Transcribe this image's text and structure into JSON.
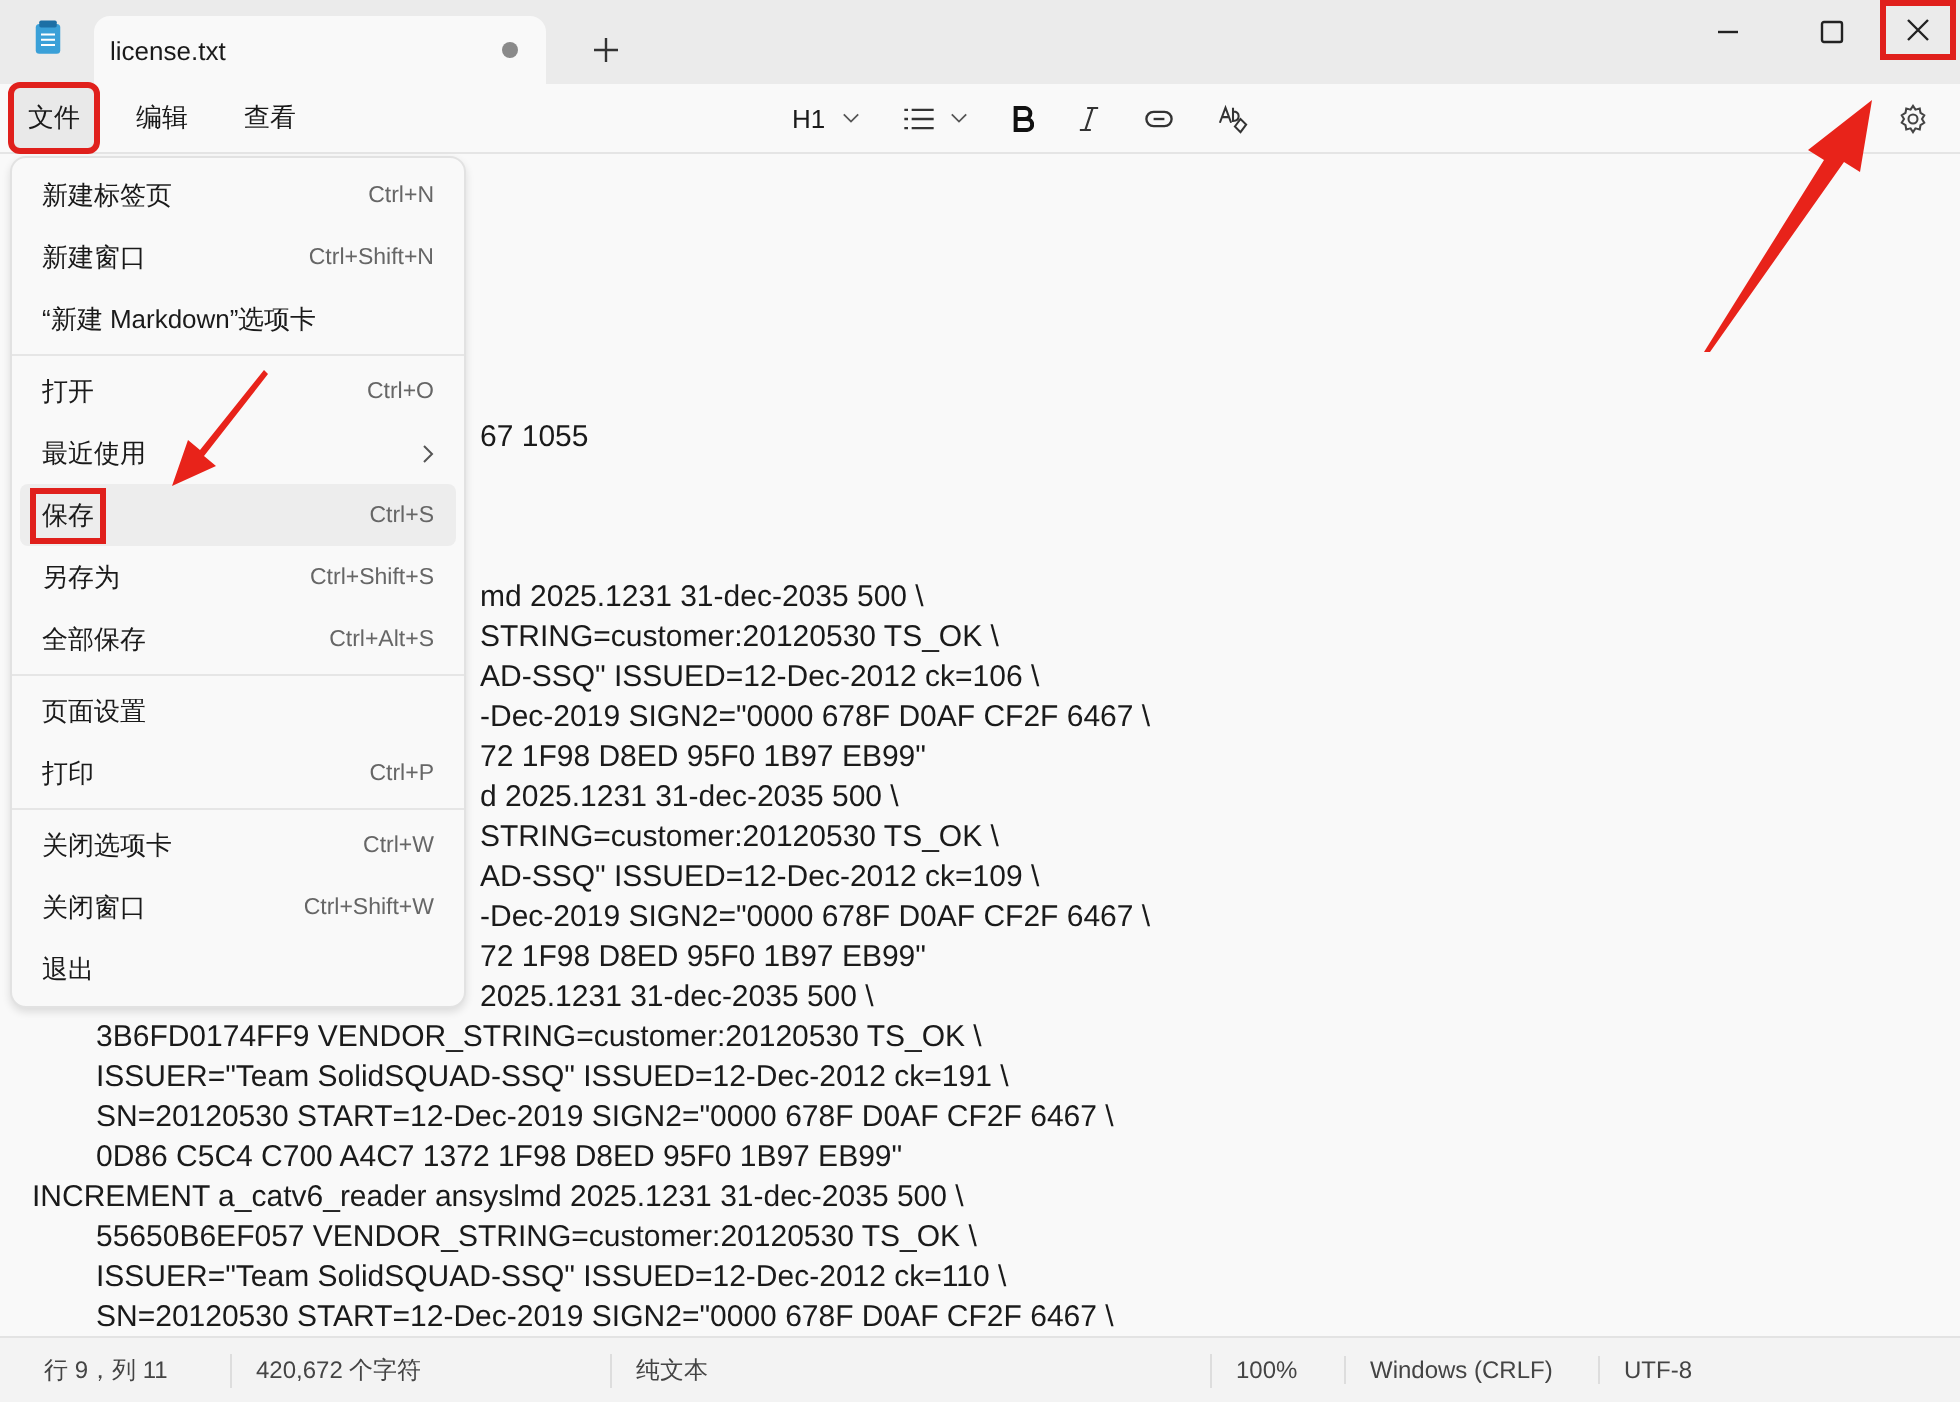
{
  "window": {
    "tab_title": "license.txt",
    "unsaved": true,
    "close_annotated": true
  },
  "menubar": [
    {
      "label": "文件",
      "selected": true,
      "annotated": true
    },
    {
      "label": "编辑",
      "selected": false,
      "annotated": false
    },
    {
      "label": "查看",
      "selected": false,
      "annotated": false
    }
  ],
  "toolbar": {
    "heading": "H1"
  },
  "file_menu": [
    [
      {
        "label": "新建标签页",
        "shortcut": "Ctrl+N",
        "selected": false,
        "annotated": false
      },
      {
        "label": "新建窗口",
        "shortcut": "Ctrl+Shift+N",
        "selected": false,
        "annotated": false
      },
      {
        "label": "“新建 Markdown”选项卡",
        "selected": false,
        "annotated": false
      }
    ],
    [
      {
        "label": "打开",
        "shortcut": "Ctrl+O",
        "selected": false,
        "annotated": false
      },
      {
        "label": "最近使用",
        "submenu": true,
        "selected": false,
        "annotated": false
      },
      {
        "label": "保存",
        "shortcut": "Ctrl+S",
        "selected": true,
        "annotated": true
      },
      {
        "label": "另存为",
        "shortcut": "Ctrl+Shift+S",
        "selected": false,
        "annotated": false
      },
      {
        "label": "全部保存",
        "shortcut": "Ctrl+Alt+S",
        "selected": false,
        "annotated": false
      }
    ],
    [
      {
        "label": "页面设置",
        "selected": false,
        "annotated": false
      },
      {
        "label": "打印",
        "shortcut": "Ctrl+P",
        "selected": false,
        "annotated": false
      }
    ],
    [
      {
        "label": "关闭选项卡",
        "shortcut": "Ctrl+W",
        "selected": false,
        "annotated": false
      },
      {
        "label": "关闭窗口",
        "shortcut": "Ctrl+Shift+W",
        "selected": false,
        "annotated": false
      },
      {
        "label": "退出",
        "selected": false,
        "annotated": false
      }
    ]
  ],
  "editor_lines": [
    {
      "kind": "blank"
    },
    {
      "kind": "blank"
    },
    {
      "kind": "blank"
    },
    {
      "kind": "blank"
    },
    {
      "kind": "blank"
    },
    {
      "kind": "blank"
    },
    {
      "kind": "cut",
      "text": "67 1055"
    },
    {
      "kind": "blank"
    },
    {
      "kind": "blank"
    },
    {
      "kind": "blank"
    },
    {
      "kind": "cut",
      "text": "md 2025.1231 31-dec-2035 500 \\"
    },
    {
      "kind": "cut",
      "text": "STRING=customer:20120530 TS_OK \\"
    },
    {
      "kind": "cut",
      "text": "AD-SSQ\" ISSUED=12-Dec-2012 ck=106 \\"
    },
    {
      "kind": "cut",
      "text": "-Dec-2019 SIGN2=\"0000 678F D0AF CF2F 6467 \\"
    },
    {
      "kind": "cut",
      "text": "72 1F98 D8ED 95F0 1B97 EB99\""
    },
    {
      "kind": "cut",
      "text": "d 2025.1231 31-dec-2035 500 \\"
    },
    {
      "kind": "cut",
      "text": "STRING=customer:20120530 TS_OK \\"
    },
    {
      "kind": "cut",
      "text": "AD-SSQ\" ISSUED=12-Dec-2012 ck=109 \\"
    },
    {
      "kind": "cut",
      "text": "-Dec-2019 SIGN2=\"0000 678F D0AF CF2F 6467 \\"
    },
    {
      "kind": "cut",
      "text": "72 1F98 D8ED 95F0 1B97 EB99\""
    },
    {
      "kind": "cut",
      "text": "2025.1231 31-dec-2035 500 \\"
    },
    {
      "kind": "cont",
      "text": "3B6FD0174FF9 VENDOR_STRING=customer:20120530 TS_OK \\"
    },
    {
      "kind": "cont",
      "text": "ISSUER=\"Team SolidSQUAD-SSQ\" ISSUED=12-Dec-2012 ck=191 \\"
    },
    {
      "kind": "cont",
      "text": "SN=20120530 START=12-Dec-2019 SIGN2=\"0000 678F D0AF CF2F 6467 \\"
    },
    {
      "kind": "cont",
      "text": "0D86 C5C4 C700 A4C7 1372 1F98 D8ED 95F0 1B97 EB99\""
    },
    {
      "kind": "head",
      "text": "INCREMENT a_catv6_reader ansyslmd 2025.1231 31-dec-2035 500 \\"
    },
    {
      "kind": "cont",
      "text": "55650B6EF057 VENDOR_STRING=customer:20120530 TS_OK \\"
    },
    {
      "kind": "cont",
      "text": "ISSUER=\"Team SolidSQUAD-SSQ\" ISSUED=12-Dec-2012 ck=110 \\"
    },
    {
      "kind": "cont",
      "text": "SN=20120530 START=12-Dec-2019 SIGN2=\"0000 678F D0AF CF2F 6467 \\"
    }
  ],
  "status_bar": {
    "position": "行 9，列 11",
    "characters": "420,672 个字符",
    "format": "纯文本",
    "zoom": "100%",
    "line_ending": "Windows (CRLF)",
    "encoding": "UTF-8"
  }
}
